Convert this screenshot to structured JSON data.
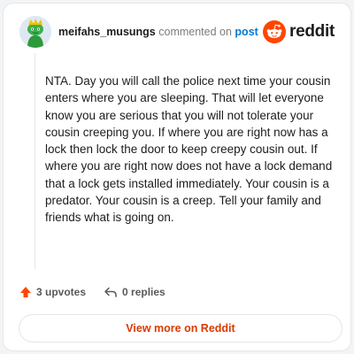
{
  "comment": {
    "author": "meifahs_musungs",
    "verb": "commented on",
    "target": "post",
    "body": "NTA. Day you will call the police next time your cousin enters where you are sleeping. That will let everyone know you are serious that you will not tolerate your cousin creeping you. If where you are right now has a lock then lock the door to keep creepy cousin out. If where you are right now does not have a lock demand that a lock gets installed immediately. Your cousin is a predator. Your cousin is a creep. Tell your family and friends what is going on."
  },
  "brand": {
    "name": "reddit",
    "logo_icon": "reddit-snoo-icon",
    "accent": "#ff4500"
  },
  "actions": {
    "upvotes": "3 upvotes",
    "replies": "0 replies",
    "upvote_icon": "upvote-arrow-icon",
    "reply_icon": "reply-arrow-icon"
  },
  "cta": {
    "label": "View more on Reddit",
    "color": "#d93a00"
  },
  "colors": {
    "post_link": "#0079d3",
    "upvote": "#ff4500"
  }
}
